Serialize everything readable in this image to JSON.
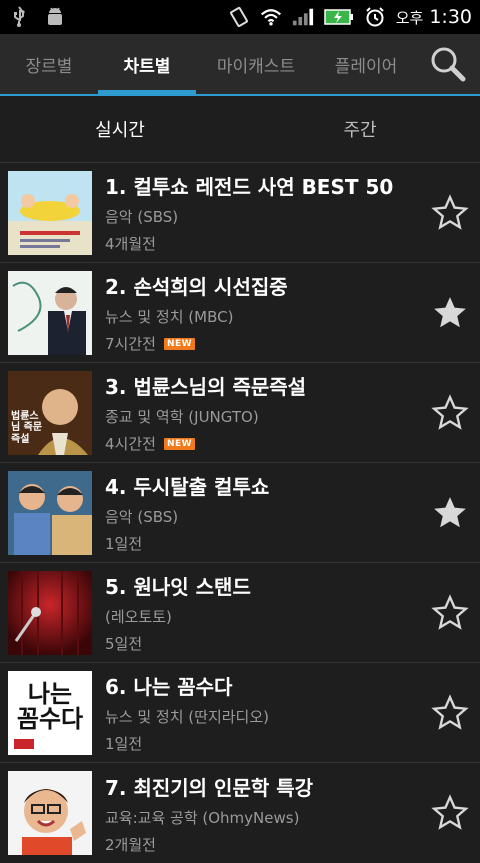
{
  "status": {
    "ampm": "오후",
    "time": "1:30"
  },
  "tabs": [
    {
      "label": "장르별",
      "active": false
    },
    {
      "label": "차트별",
      "active": true
    },
    {
      "label": "마이캐스트",
      "active": false
    },
    {
      "label": "플레이어",
      "active": false
    }
  ],
  "subtabs": [
    {
      "label": "실시간",
      "active": true
    },
    {
      "label": "주간",
      "active": false
    }
  ],
  "items": [
    {
      "title": "1. 컬투쇼 레전드 사연 BEST 50",
      "category": "음악 (SBS)",
      "when": "4개월전",
      "new": "",
      "starred": false,
      "thumb": "thumb-1"
    },
    {
      "title": "2. 손석희의 시선집중",
      "category": "뉴스 및 정치 (MBC)",
      "when": "7시간전",
      "new": "NEW",
      "starred": true,
      "thumb": "thumb-2"
    },
    {
      "title": "3. 법륜스님의 즉문즉설",
      "category": "종교 및 역학 (JUNGTO)",
      "when": "4시간전",
      "new": "NEW",
      "starred": false,
      "thumb": "thumb-3"
    },
    {
      "title": "4. 두시탈출 컬투쇼",
      "category": "음악 (SBS)",
      "when": "1일전",
      "new": "",
      "starred": true,
      "thumb": "thumb-4"
    },
    {
      "title": "5. 원나잇 스탠드",
      "category": "(레오토토)",
      "when": "5일전",
      "new": "",
      "starred": false,
      "thumb": "thumb-5"
    },
    {
      "title": "6. 나는 꼼수다",
      "category": "뉴스 및 정치 (딴지라디오)",
      "when": "1일전",
      "new": "",
      "starred": false,
      "thumb": "thumb-6"
    },
    {
      "title": "7. 최진기의 인문학 특강",
      "category": "교육:교육 공학 (OhmyNews)",
      "when": "2개월전",
      "new": "",
      "starred": false,
      "thumb": "thumb-7"
    }
  ],
  "thumb_text": {
    "thumb3": "법륜스님 즉문 즉설",
    "thumb6": "나는 꼼수다"
  },
  "colors": {
    "accent": "#2f9bd0",
    "new_badge": "#f07a1c"
  }
}
